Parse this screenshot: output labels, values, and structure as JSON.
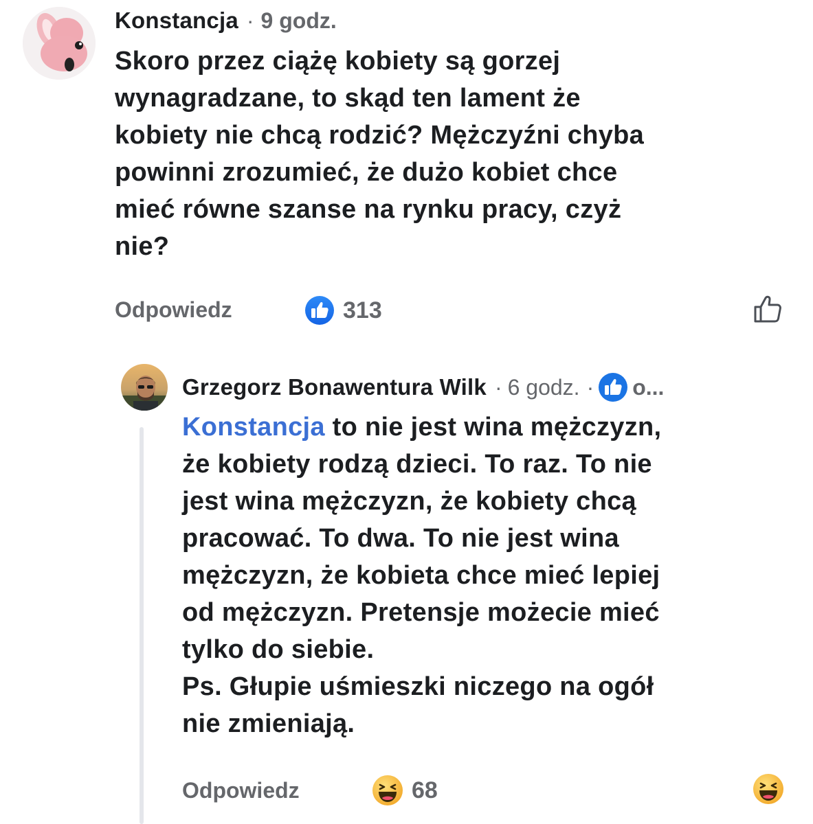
{
  "comment": {
    "author": "Konstancja",
    "separator": "·",
    "time": "9 godz.",
    "lines": [
      "Skoro przez ciążę kobiety są gorzej",
      "wynagradzane, to skąd ten lament że",
      "kobiety nie chcą rodzić? Mężczyźni chyba",
      "powinni zrozumieć, że dużo kobiet chce",
      "mieć równe szanse na rynku pracy, czyż",
      "nie?"
    ],
    "reply_label": "Odpowiedz",
    "reaction_icon": "like-icon",
    "reaction_count": "313",
    "like_button_icon": "thumbs-up-outline-icon"
  },
  "reply": {
    "author": "Grzegorz Bonawentura Wilk",
    "separator": "·",
    "time": "6 godz.",
    "separator2": "·",
    "follow_badge_icon": "like-badge-icon",
    "follow_truncated": "o...",
    "mention": "Konstancja",
    "first_line_rest": " to nie jest wina mężczyzn,",
    "lines": [
      "że kobiety rodzą dzieci. To raz. To nie",
      "jest wina mężczyzn, że kobiety chcą",
      "pracować. To dwa. To nie jest wina",
      "mężczyzn, że kobieta chce mieć lepiej",
      "od mężczyzn. Pretensje możecie mieć",
      "tylko do siebie.",
      "Ps. Głupie uśmieszki niczego na ogół",
      "nie zmieniają."
    ],
    "reply_label": "Odpowiedz",
    "reaction_icon": "haha-emoji-icon",
    "reaction_count": "68",
    "react_button_icon": "haha-emoji-icon"
  },
  "colors": {
    "accent": "#1877f2",
    "mention": "#3b6fd4",
    "secondary_text": "#65676b",
    "haha_yellow": "#f7b928"
  }
}
